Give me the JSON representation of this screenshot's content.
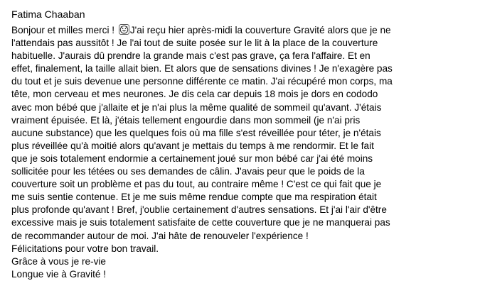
{
  "review": {
    "author": "Fatima Chaaban",
    "emoji_icon": "grinning-face-icon",
    "line1_before_emoji": "Bonjour et milles merci ! ",
    "line1_after_emoji": "J'ai reçu hier après-midi la couverture Gravité alors que je ne",
    "lines": [
      "l'attendais pas aussitôt ! Je l'ai tout de suite posée sur le lit à la place de la couverture",
      "habituelle. J'aurais dû prendre la grande mais c'est pas grave, ça fera l'affaire. Et en",
      "effet, finalement, la taille allait bien. Et alors que de sensations divines ! Je n'exagère pas",
      "du tout et je suis devenue une personne différente ce matin. J'ai récupéré mon corps, ma",
      "tête, mon cerveau et mes neurones. Je dis cela car depuis 18 mois je dors en cododo",
      "avec mon bébé que j'allaite et je n'ai plus la même qualité de sommeil qu'avant. J'étais",
      "vraiment épuisée. Et là, j'étais tellement engourdie dans mon sommeil (je n'ai pris",
      "aucune substance) que les quelques fois où ma fille s'est réveillée pour téter, je n'étais",
      "plus réveillée qu'à moitié alors qu'avant je mettais du temps à me rendormir. Et le fait",
      "que je sois totalement endormie a certainement joué sur mon bébé car j'ai été moins",
      "sollicitée pour les tétées ou ses demandes de câlin. J'avais peur que le poids de la",
      "couverture soit un problème et pas du tout, au contraire même ! C'est ce qui fait que je",
      "me suis sentie contenue. Et je me suis même rendue compte que ma respiration était",
      "plus profonde qu'avant ! Bref, j'oublie certainement d'autres sensations. Et j'ai l'air d'être",
      "excessive mais je suis totalement satisfaite de cette couverture que je ne manquerai pas",
      "de recommander autour de moi. J'ai hâte de renouveler l'expérience !",
      "Félicitations pour votre bon travail.",
      "Grâce à vous je re-vie",
      "Longue vie à Gravité !"
    ]
  }
}
